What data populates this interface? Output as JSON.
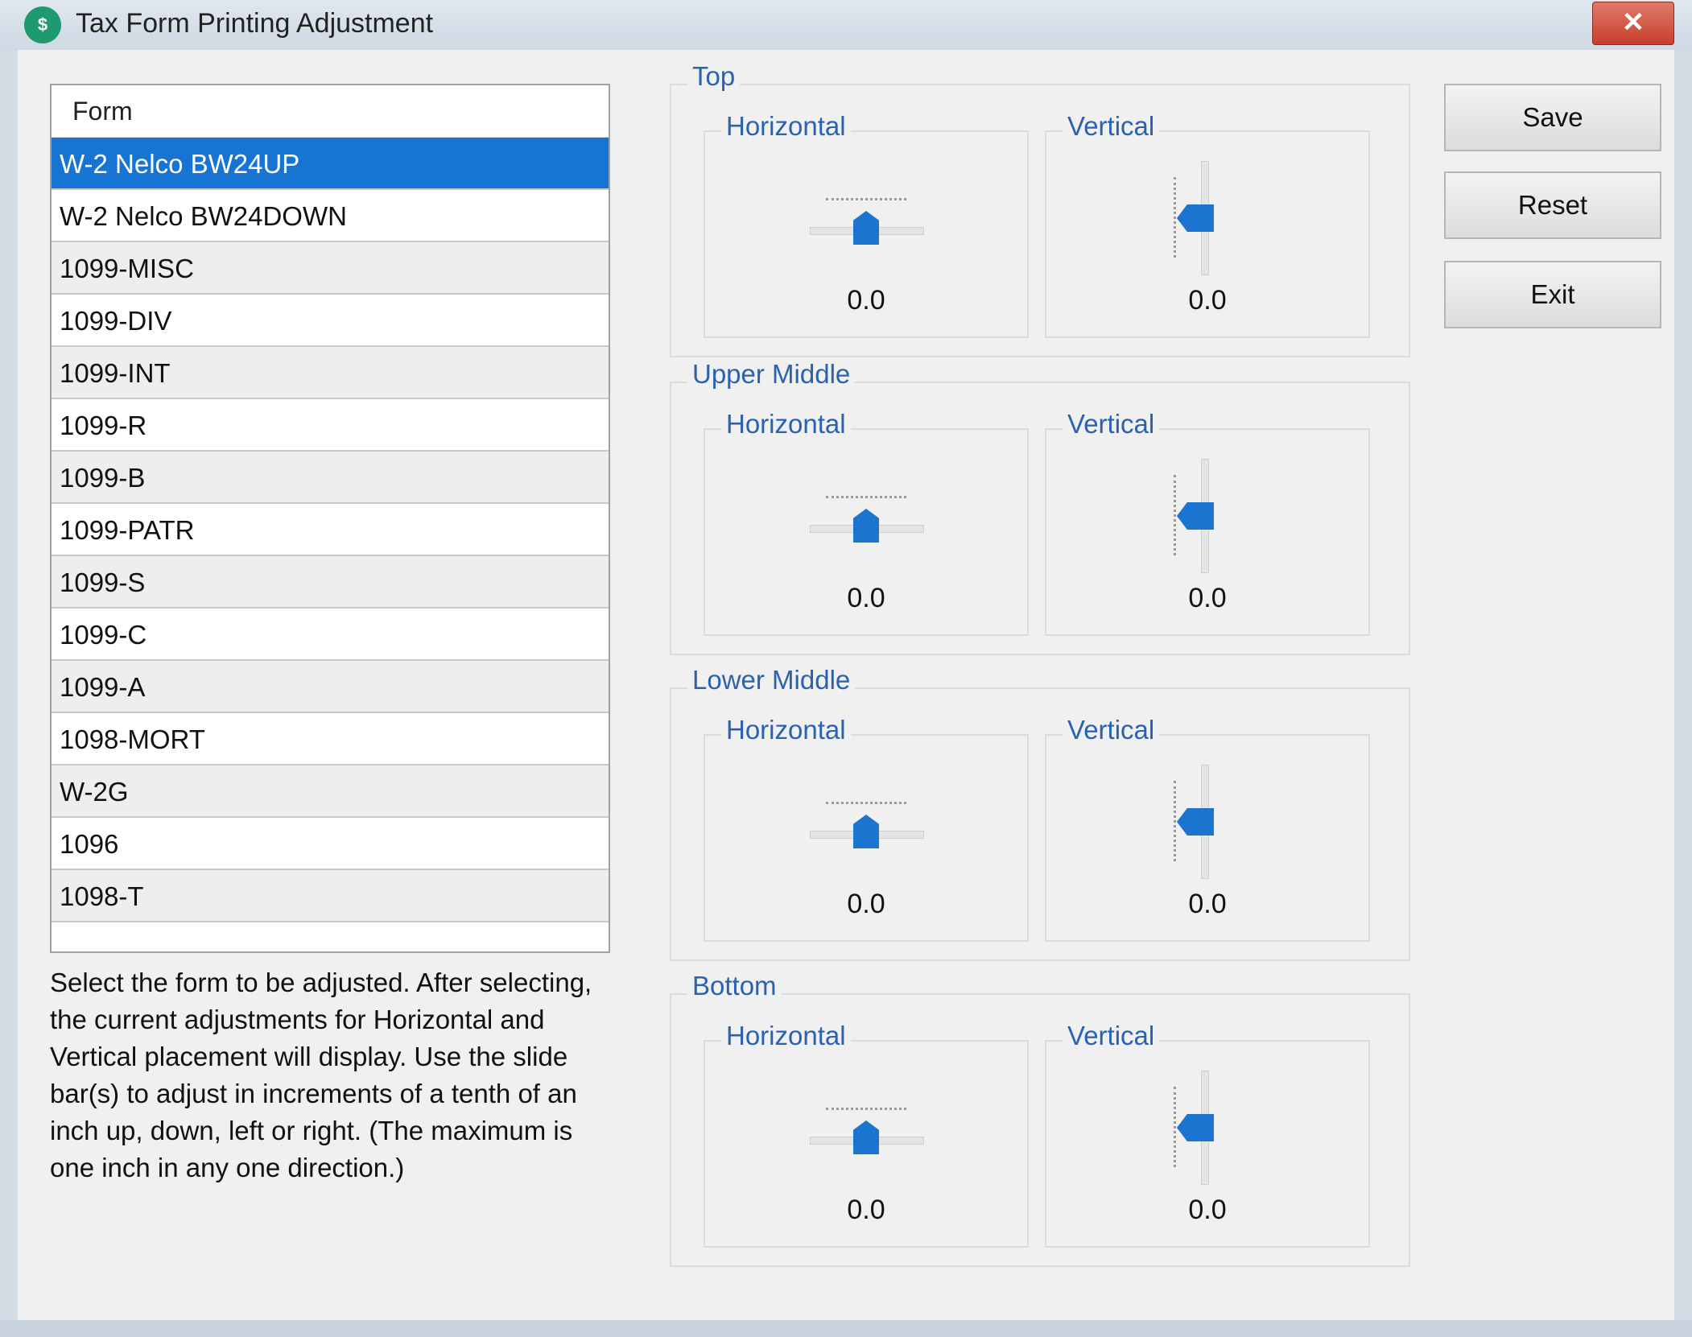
{
  "window": {
    "title": "Tax Form Printing Adjustment",
    "close_label": "✕",
    "app_icon_glyph": "$"
  },
  "list": {
    "header": "Form",
    "selected_index": 0,
    "items": [
      "W-2 Nelco BW24UP",
      "W-2 Nelco BW24DOWN",
      "1099-MISC",
      "1099-DIV",
      "1099-INT",
      "1099-R",
      "1099-B",
      "1099-PATR",
      "1099-S",
      "1099-C",
      "1099-A",
      "1098-MORT",
      "W-2G",
      "1096",
      "1098-T"
    ]
  },
  "instructions": "Select the form to be adjusted.  After selecting, the current adjustments for Horizontal and Vertical placement will display. Use the slide bar(s) to adjust in increments of a tenth of an inch up, down, left or right.  (The maximum is one inch in any one direction.)",
  "groups": [
    {
      "title": "Top",
      "horizontal_label": "Horizontal",
      "vertical_label": "Vertical",
      "horizontal_value": "0.0",
      "vertical_value": "0.0"
    },
    {
      "title": "Upper Middle",
      "horizontal_label": "Horizontal",
      "vertical_label": "Vertical",
      "horizontal_value": "0.0",
      "vertical_value": "0.0"
    },
    {
      "title": "Lower Middle",
      "horizontal_label": "Horizontal",
      "vertical_label": "Vertical",
      "horizontal_value": "0.0",
      "vertical_value": "0.0"
    },
    {
      "title": "Bottom",
      "horizontal_label": "Horizontal",
      "vertical_label": "Vertical",
      "horizontal_value": "0.0",
      "vertical_value": "0.0"
    }
  ],
  "buttons": {
    "save": "Save",
    "reset": "Reset",
    "exit": "Exit"
  },
  "colors": {
    "accent": "#1874d2",
    "group_label": "#2a62b0"
  }
}
